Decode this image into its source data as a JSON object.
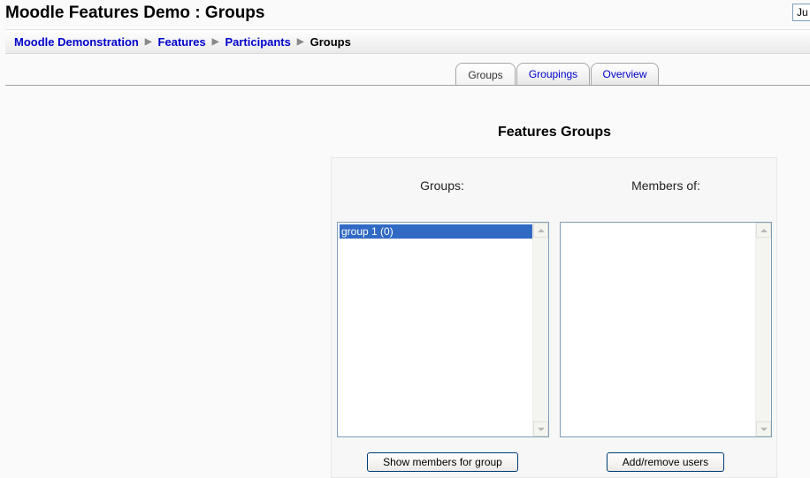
{
  "header": {
    "title": "Moodle Features Demo : Groups",
    "jump_value": "Ju"
  },
  "breadcrumb": {
    "items": [
      "Moodle Demonstration",
      "Features",
      "Participants"
    ],
    "current": "Groups",
    "separator": "▶"
  },
  "tabs": [
    {
      "label": "Groups",
      "active": true
    },
    {
      "label": "Groupings",
      "active": false
    },
    {
      "label": "Overview",
      "active": false
    }
  ],
  "main": {
    "heading": "Features Groups",
    "groups_label": "Groups:",
    "members_label": "Members of:",
    "groups_list": [
      "group 1 (0)"
    ],
    "members_list": [],
    "show_members_button": "Show members for group",
    "add_remove_button": "Add/remove users"
  },
  "colors": {
    "link": "#0000cc",
    "selection": "#316ac5"
  }
}
